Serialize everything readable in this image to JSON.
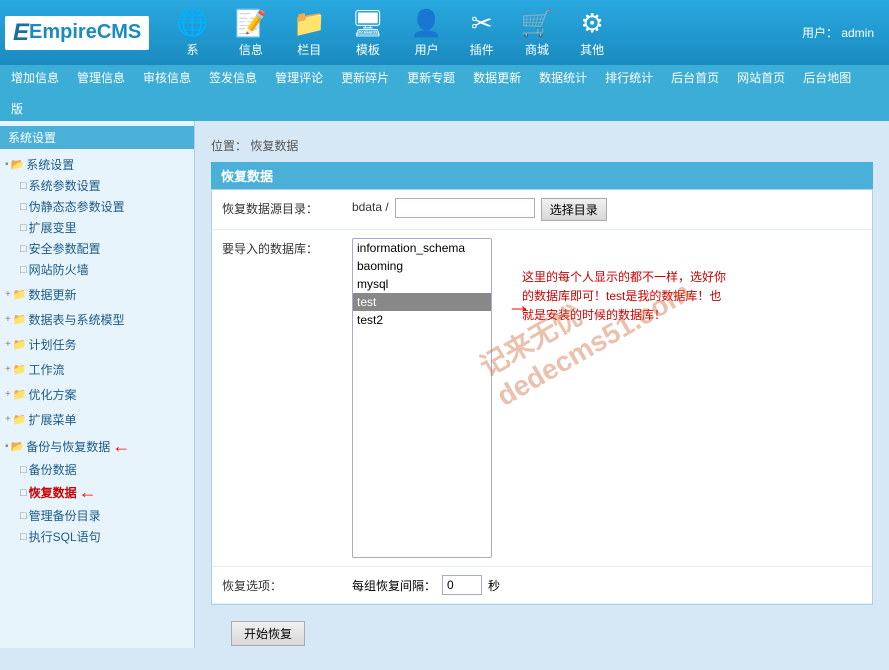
{
  "header": {
    "logo_text": "EmpireCMS",
    "user_label": "用户：",
    "username": "admin",
    "nav_items": [
      {
        "id": "system",
        "label": "系",
        "icon": "🌐"
      },
      {
        "id": "info",
        "label": "信息",
        "icon": "📝"
      },
      {
        "id": "column",
        "label": "栏目",
        "icon": "📁"
      },
      {
        "id": "template",
        "label": "模板",
        "icon": "🖥"
      },
      {
        "id": "user",
        "label": "用户",
        "icon": "👤"
      },
      {
        "id": "plugin",
        "label": "插件",
        "icon": "✂"
      },
      {
        "id": "shop",
        "label": "商城",
        "icon": "🛒"
      },
      {
        "id": "other",
        "label": "其他",
        "icon": "⚙"
      }
    ]
  },
  "secondary_nav": [
    "增加信息",
    "管理信息",
    "审核信息",
    "签发信息",
    "管理评论",
    "更新碎片",
    "更新专题",
    "数据更新",
    "数据统计",
    "排行统计",
    "后台首页",
    "网站首页",
    "后台地图",
    "版"
  ],
  "breadcrumb": {
    "label": "位置：",
    "current": "恢复数据"
  },
  "panel": {
    "title": "恢复数据",
    "rows": [
      {
        "id": "dir",
        "label": "恢复数据源目录：",
        "prefix": "bdata /",
        "input_value": "",
        "button_label": "选择目录"
      },
      {
        "id": "database",
        "label": "要导入的数据库：",
        "options": [
          {
            "value": "information_schema",
            "label": "information_schema",
            "selected": false
          },
          {
            "value": "baoming",
            "label": "baoming",
            "selected": false
          },
          {
            "value": "mysql",
            "label": "mysql",
            "selected": false
          },
          {
            "value": "test",
            "label": "test",
            "selected": true
          },
          {
            "value": "test2",
            "label": "test2",
            "selected": false
          }
        ]
      },
      {
        "id": "options",
        "label": "恢复选项：",
        "interval_label": "每组恢复间隔：",
        "interval_value": "0",
        "interval_unit": "秒"
      }
    ],
    "start_button_label": "开始恢复"
  },
  "sidebar": {
    "title": "系统设置",
    "tree": [
      {
        "label": "系统设置",
        "type": "root",
        "expanded": true,
        "children": [
          {
            "label": "系统参数设置",
            "type": "child"
          },
          {
            "label": "伪静态态参数设置",
            "type": "child"
          },
          {
            "label": "扩展变里",
            "type": "child"
          },
          {
            "label": "安全参数配置",
            "type": "child"
          },
          {
            "label": "网站防火墙",
            "type": "child"
          }
        ]
      },
      {
        "label": "数据更新",
        "type": "root",
        "expanded": false
      },
      {
        "label": "数据表与系统模型",
        "type": "root",
        "expanded": false
      },
      {
        "label": "计划任务",
        "type": "root",
        "expanded": false
      },
      {
        "label": "工作流",
        "type": "root",
        "expanded": false
      },
      {
        "label": "优化方案",
        "type": "root",
        "expanded": false
      },
      {
        "label": "扩展菜单",
        "type": "root",
        "expanded": false
      },
      {
        "label": "备份与恢复数据",
        "type": "root",
        "expanded": true,
        "arrow": true,
        "children": [
          {
            "label": "备份数据",
            "type": "child"
          },
          {
            "label": "恢复数据",
            "type": "child",
            "arrow": true
          },
          {
            "label": "管理备份目录",
            "type": "child"
          },
          {
            "label": "执行SQL语句",
            "type": "child"
          }
        ]
      }
    ]
  },
  "annotation": {
    "text": "这里的每个人显示的都不一样，选好你\n的数据库即可！test是我的数据库！也\n就是安装的时候的数据库！"
  },
  "watermark": "记来无忧\ndedecms51.com"
}
